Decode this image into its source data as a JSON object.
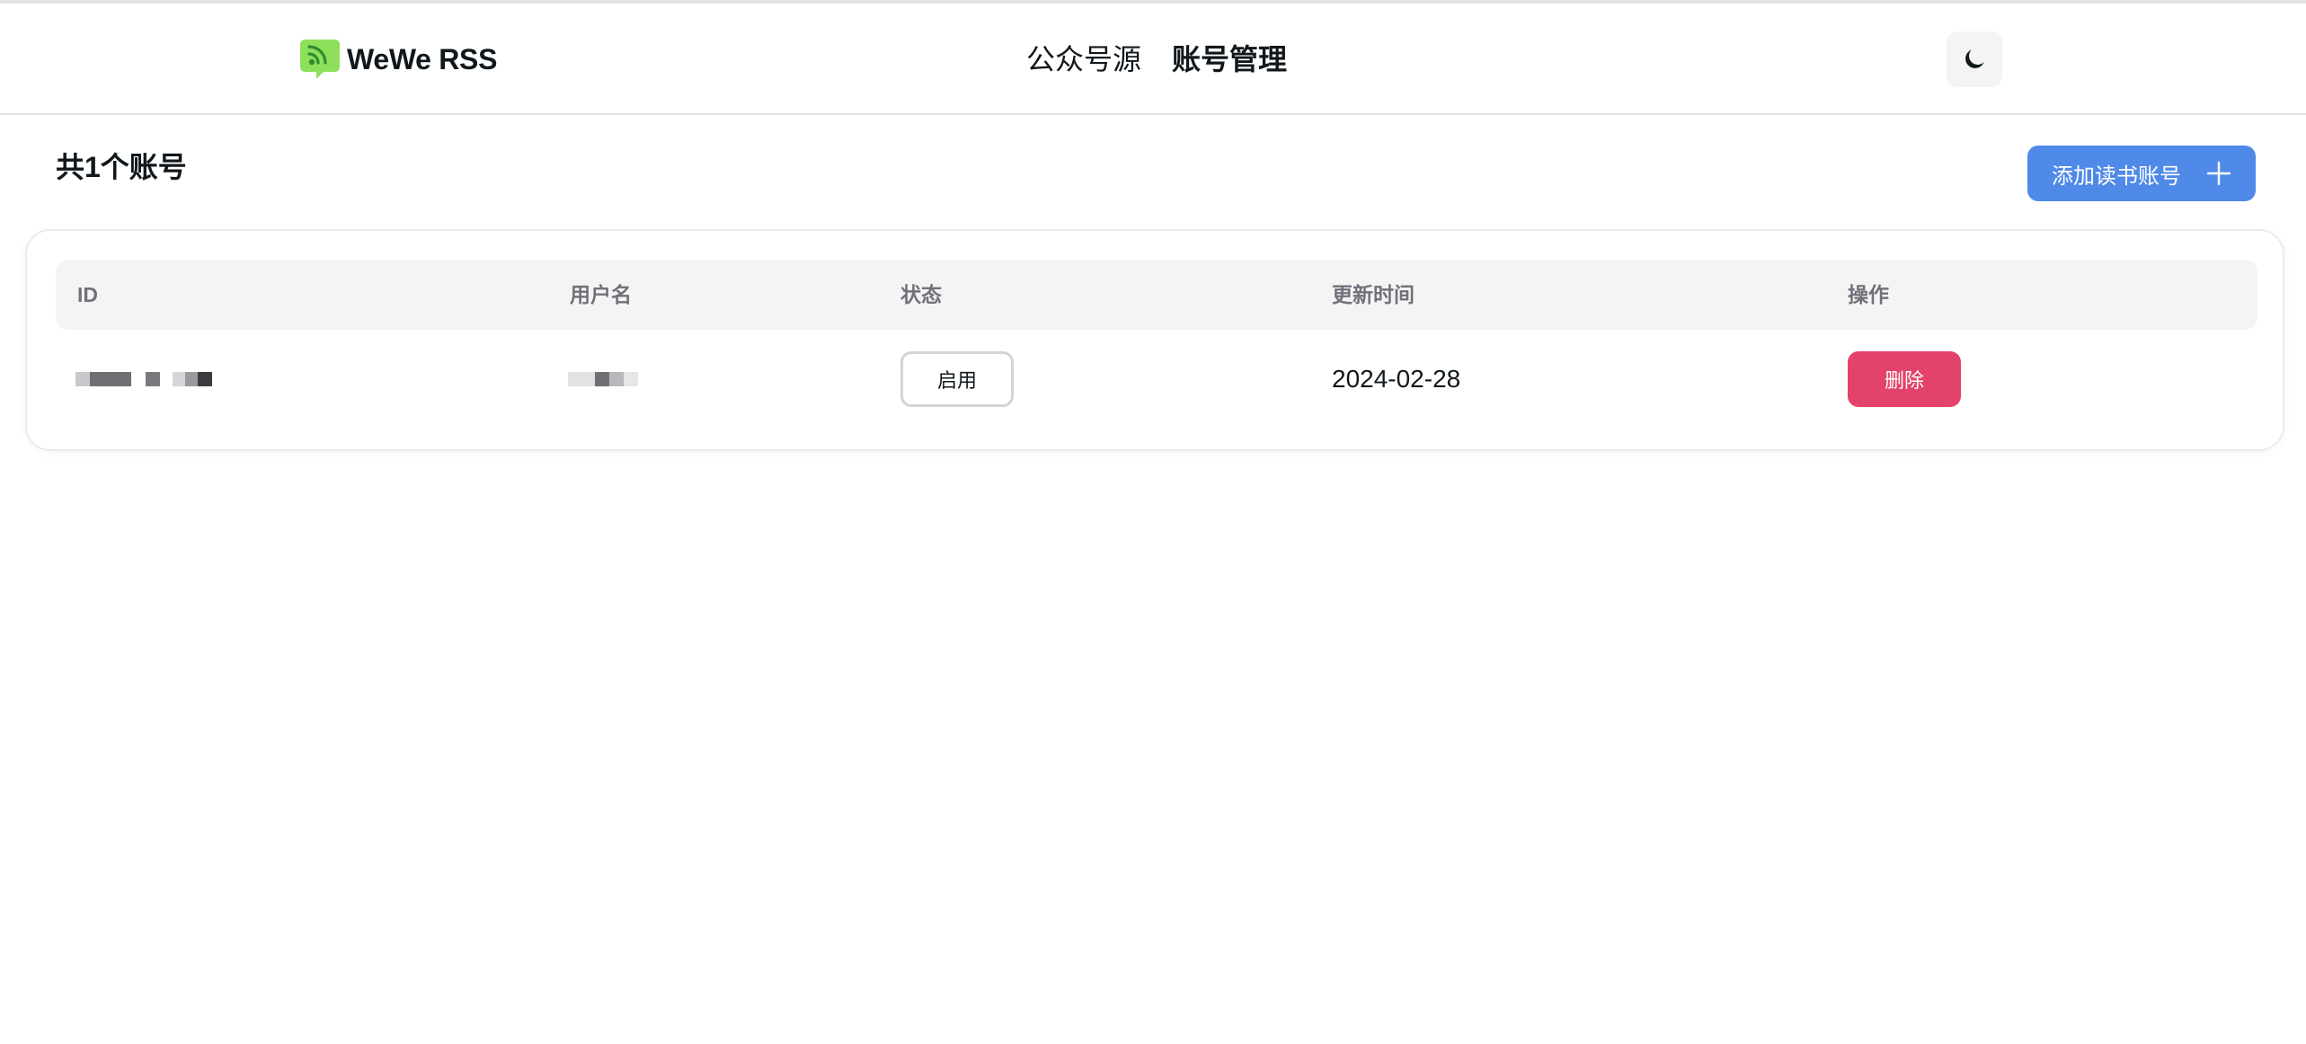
{
  "app": {
    "name": "WeWe RSS",
    "colors": {
      "brand": "#8ee05c",
      "primary": "#4f8ae8",
      "danger": "#e3426a"
    }
  },
  "nav": {
    "items": [
      {
        "label": "公众号源",
        "active": false
      },
      {
        "label": "账号管理",
        "active": true
      }
    ],
    "theme_toggle_icon": "moon-icon"
  },
  "summary": {
    "text": "共1个账号"
  },
  "toolbar": {
    "add_label": "添加读书账号",
    "add_icon": "plus-icon"
  },
  "table": {
    "headers": [
      "ID",
      "用户名",
      "状态",
      "更新时间",
      "操作"
    ],
    "rows": [
      {
        "id": "",
        "username": "",
        "status_label": "启用",
        "updated": "2024-02-28",
        "action_label": "删除"
      }
    ]
  }
}
